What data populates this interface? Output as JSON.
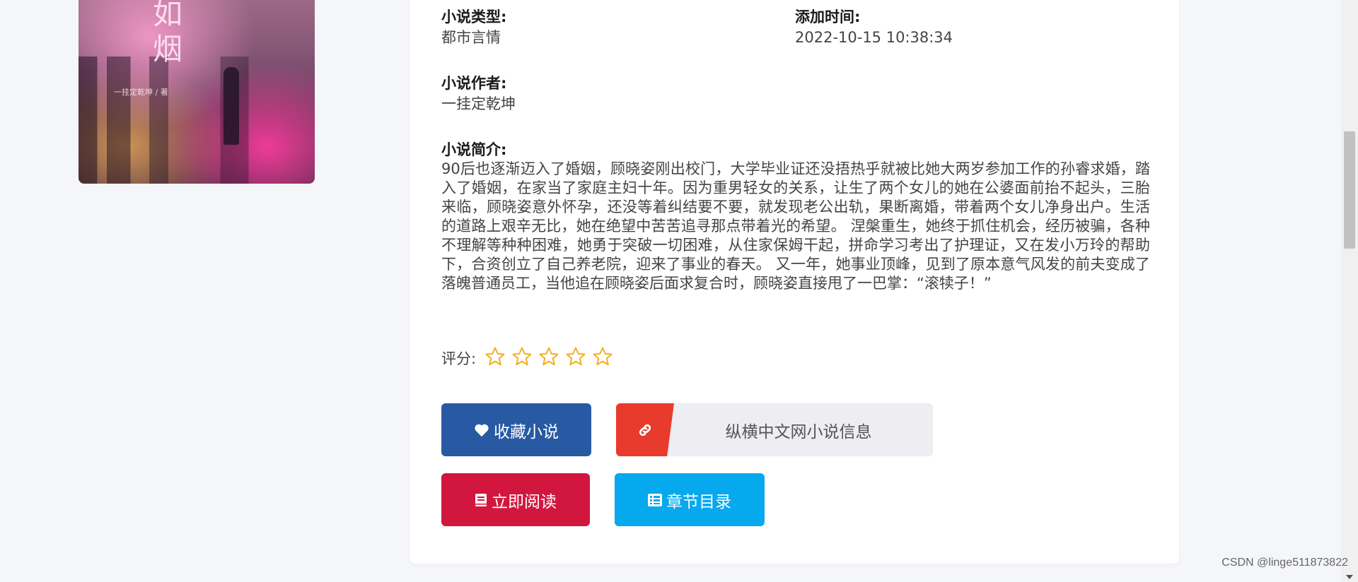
{
  "cover": {
    "glyph_top": "如",
    "glyph_bottom": "烟",
    "byline": "一挂定乾坤 / 著"
  },
  "details": {
    "type_label": "小说类型:",
    "type_value": "都市言情",
    "added_label": "添加时间:",
    "added_value": "2022-10-15 10:38:34",
    "author_label": "小说作者:",
    "author_value": "一挂定乾坤",
    "desc_label": "小说简介:",
    "desc_value": "90后也逐渐迈入了婚姻，顾晓姿刚出校门，大学毕业证还没捂热乎就被比她大两岁参加工作的孙睿求婚，踏入了婚姻，在家当了家庭主妇十年。因为重男轻女的关系，让生了两个女儿的她在公婆面前抬不起头，三胎来临，顾晓姿意外怀孕，还没等着纠结要不要，就发现老公出轨，果断离婚，带着两个女儿净身出户。生活的道路上艰辛无比，她在绝望中苦苦追寻那点带着光的希望。 涅槃重生，她终于抓住机会，经历被骗，各种不理解等种种困难，她勇于突破一切困难，从住家保姆干起，拼命学习考出了护理证，又在发小万玲的帮助下，合资创立了自己养老院，迎来了事业的春天。 又一年，她事业顶峰，见到了原本意气风发的前夫变成了落魄普通员工，当他追在顾晓姿后面求复合时，顾晓姿直接甩了一巴掌：“滚犊子！”"
  },
  "rating": {
    "label": "评分:",
    "value": 0,
    "max": 5,
    "star_color": "#f2b01e"
  },
  "buttons": {
    "favorite_label": "收藏小说",
    "link_label": "纵横中文网小说信息",
    "read_label": "立即阅读",
    "toc_label": "章节目录"
  },
  "colors": {
    "favorite": "#285aa3",
    "link_badge": "#e83b2d",
    "read": "#d2173f",
    "toc": "#06a8ee"
  },
  "icons": {
    "favorite": "heart-icon",
    "link": "link-icon",
    "read": "book-icon",
    "toc": "list-icon",
    "star": "star-outline-icon"
  },
  "watermark": "CSDN @linge511873822"
}
